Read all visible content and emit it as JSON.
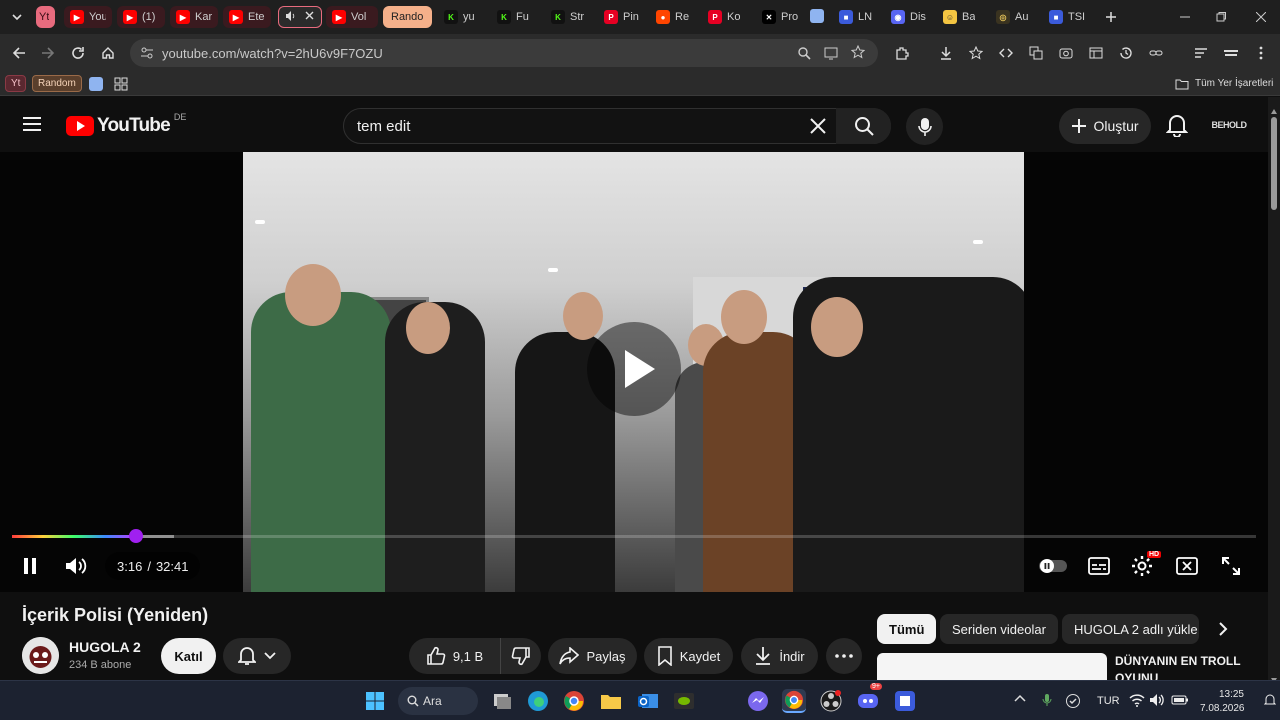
{
  "browser": {
    "tabs": [
      {
        "label": "Yt",
        "kind": "group-red"
      },
      {
        "label": "You",
        "kind": "red"
      },
      {
        "label": "(1)",
        "kind": "red"
      },
      {
        "label": "Kar",
        "kind": "red"
      },
      {
        "label": "Ete",
        "kind": "red"
      },
      {
        "label": "",
        "kind": "active"
      },
      {
        "label": "Vol",
        "kind": "red"
      },
      {
        "label": "Random",
        "kind": "group-orange"
      },
      {
        "label": "yu",
        "kind": "kick"
      },
      {
        "label": "Fu",
        "kind": "kick"
      },
      {
        "label": "Str",
        "kind": "kick"
      },
      {
        "label": "Pin",
        "kind": "pinterest"
      },
      {
        "label": "Re",
        "kind": "reddit"
      },
      {
        "label": "Ko",
        "kind": "pinterest"
      },
      {
        "label": "Pro",
        "kind": "x"
      },
      {
        "label": "",
        "kind": "blue-square"
      },
      {
        "label": "LN",
        "kind": "blue"
      },
      {
        "label": "Dis",
        "kind": "discord"
      },
      {
        "label": "Ba",
        "kind": "emoji"
      },
      {
        "label": "Au",
        "kind": "gold"
      },
      {
        "label": "TSI",
        "kind": "blue"
      }
    ],
    "url": "youtube.com/watch?v=2hU6v9F7OZU",
    "bookmarks": {
      "yt": "Yt",
      "random": "Random",
      "all_bookmarks": "Tüm Yer İşaretleri"
    }
  },
  "youtube": {
    "logo_text": "YouTube",
    "region": "DE",
    "search_value": "tem edit",
    "create_label": "Oluştur",
    "channel_avatar_top_text": "BEHOLD",
    "player": {
      "time_current": "3:16",
      "time_total": "32:41",
      "progress_fraction": 0.1,
      "buffer_fraction": 0.13,
      "hd_badge": "HD"
    },
    "video": {
      "title": "İçerik Polisi (Yeniden)",
      "channel": "HUGOLA 2",
      "subscribers": "234 B abone",
      "join_label": "Katıl",
      "likes": "9,1 B",
      "share_label": "Paylaş",
      "save_label": "Kaydet",
      "download_label": "İndir"
    },
    "chips": [
      "Tümü",
      "Seriden videolar",
      "HUGOLA 2 adlı yükle"
    ],
    "recommendation": {
      "title": "DÜNYANIN EN TROLL OYUNU"
    }
  },
  "taskbar": {
    "search_label": "Ara",
    "language": "TUR",
    "time": "13:25",
    "date": "7.08.2026",
    "discord_badge": "9+"
  },
  "colors": {
    "yt_red": "#ff0000",
    "progress_thumb": "#a020f0",
    "tab_group_red": "#e86b7e",
    "tab_group_orange": "#f5b08a"
  }
}
